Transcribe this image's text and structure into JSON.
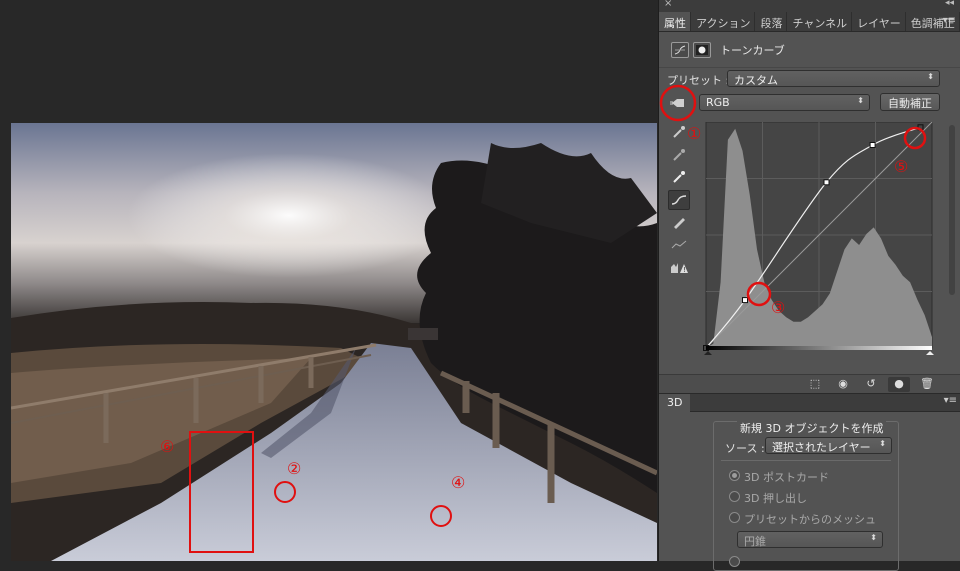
{
  "panel": {
    "close_glyph": "×",
    "collapse_glyph": "◂◂",
    "menu_glyph": "▾≡",
    "tabs": [
      "属性",
      "アクション",
      "段落",
      "チャンネル",
      "レイヤー",
      "色調補正"
    ],
    "properties_title": "トーンカーブ",
    "preset_label": "プリセット :",
    "preset_value": "カスタム",
    "channel_value": "RGB",
    "auto_button": "自動補正",
    "three_d_tab": "3D",
    "new_3d_title": "新規 3D オブジェクトを作成",
    "source_label": "ソース :",
    "source_value": "選択されたレイヤー",
    "options": [
      {
        "label": "3D ポストカード",
        "selected": true
      },
      {
        "label": "3D 押し出し",
        "selected": false
      },
      {
        "label": "プリセットからのメッシュ",
        "selected": false
      }
    ],
    "mesh_value": "円錐"
  },
  "annotations": {
    "markers": [
      "①",
      "②",
      "③",
      "④",
      "⑤",
      "⑥"
    ],
    "color": "#e01010"
  },
  "curve": {
    "points": [
      [
        0,
        0
      ],
      [
        44,
        54
      ],
      [
        136,
        187
      ],
      [
        188,
        229
      ],
      [
        242,
        249
      ]
    ],
    "input_range": [
      0,
      255
    ],
    "output_range": [
      0,
      255
    ]
  }
}
